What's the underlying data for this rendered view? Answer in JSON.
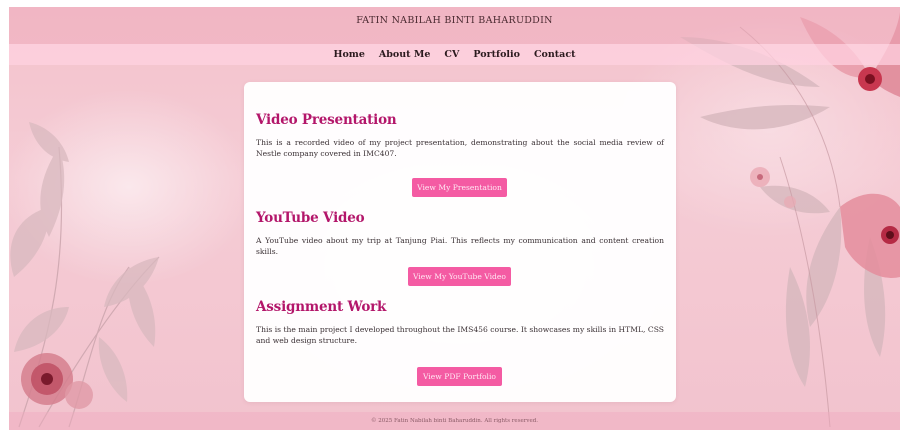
{
  "header": {
    "title": "FATIN NABILAH BINTI BAHARUDDIN"
  },
  "nav": {
    "items": [
      "Home",
      "About Me",
      "CV",
      "Portfolio",
      "Contact"
    ]
  },
  "sections": [
    {
      "title": "Video Presentation",
      "text": "This is a recorded video of my project presentation, demonstrating about the social media review of Nestle company covered in IMC407.",
      "button": "View My Presentation"
    },
    {
      "title": "YouTube Video",
      "text": "A YouTube video about my trip at Tanjung Piai. This reflects my communication and content creation skills.",
      "button": "View My YouTube Video"
    },
    {
      "title": "Assignment Work",
      "text": "This is the main project I developed throughout the IMS456 course. It showcases my skills in HTML, CSS and web design structure.",
      "button": "View PDF Portfolio"
    }
  ],
  "footer": {
    "text": "© 2025 Fatin Nabilah binti Baharuddin. All rights reserved."
  },
  "colors": {
    "accent": "#b3166a",
    "button": "#f45ba3",
    "background": "#f3c2cc"
  }
}
